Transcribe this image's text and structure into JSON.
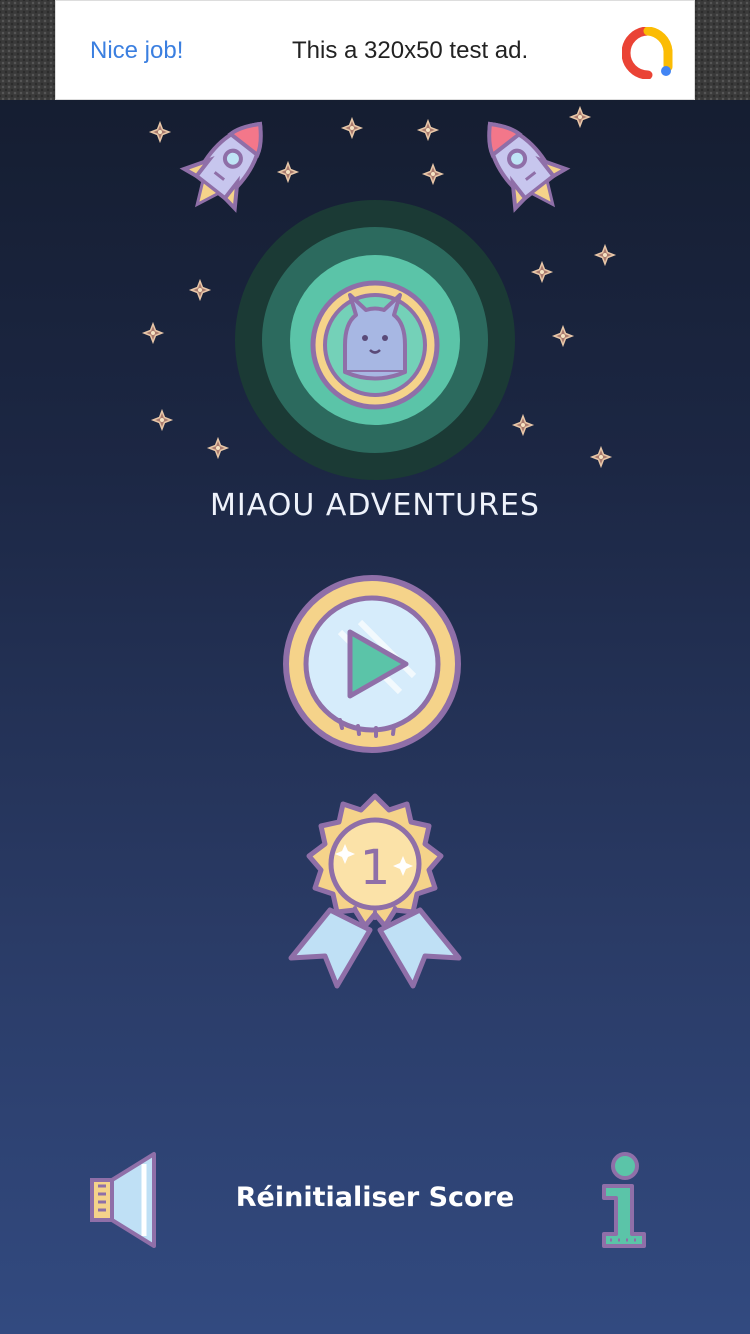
{
  "ad": {
    "label": "Nice job!",
    "text": "This a 320x50 test ad.",
    "logo_icon": "adsense-logo-icon"
  },
  "game": {
    "title": "MIAOU ADVENTURES",
    "medal_rank": "1",
    "reset_label": "Réinitialiser Score"
  },
  "icons": {
    "play": "play-icon",
    "medal": "medal-icon",
    "sound": "speaker-icon",
    "info": "info-icon",
    "cat": "cat-icon",
    "rocket": "rocket-icon",
    "star": "star-icon"
  },
  "colors": {
    "bg_top": "#131b2c",
    "bg_bottom": "#324a80",
    "ad_link": "#3b7fe0",
    "gold": "#f5d38a",
    "purple_outline": "#8f6fa8",
    "teal": "#5bc4a8"
  }
}
